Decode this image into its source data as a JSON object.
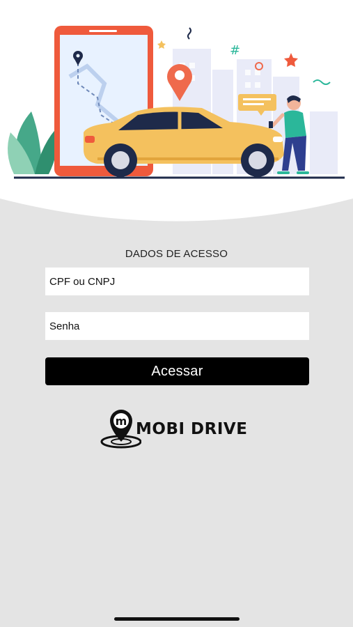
{
  "form": {
    "title": "DADOS DE ACESSO",
    "cpf_placeholder": "CPF ou CNPJ",
    "password_placeholder": "Senha",
    "submit_label": "Acessar"
  },
  "brand": {
    "logo_mark": "m",
    "name": "MOBI DRIVE"
  },
  "colors": {
    "background": "#e4e4e4",
    "button": "#000000",
    "phone": "#ef5a3c",
    "car": "#f4c15e",
    "person_shirt": "#2bb79a"
  },
  "illustration": {
    "icons": [
      "map-pin-icon",
      "location-marker-icon",
      "hashtag-icon",
      "star-icon",
      "chat-bubble-icon"
    ]
  }
}
